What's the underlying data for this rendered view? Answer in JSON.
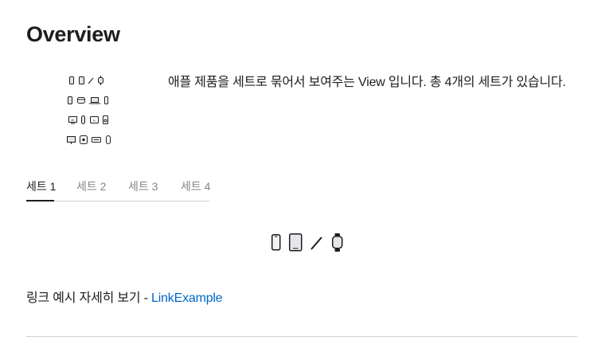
{
  "header": {
    "title": "Overview"
  },
  "preview": {
    "rows": [
      [
        "iphone-icon",
        "ipad-icon",
        "apple-pencil-icon",
        "apple-watch-icon"
      ],
      [
        "iphone-icon",
        "airpods-case-icon",
        "macbook-icon",
        "iphone-side-icon"
      ],
      [
        "apple-tv-4k-icon",
        "airtag-icon",
        "apple-tv-box-icon",
        "homepod-mini-icon"
      ],
      [
        "imac-icon",
        "mac-mini-icon",
        "keyboard-icon",
        "mouse-icon"
      ]
    ]
  },
  "description": "애플 제품을 세트로 묶어서 보여주는 View 입니다. 총 4개의 세트가 있습니다.",
  "tabs": [
    {
      "label": "세트 1",
      "active": true
    },
    {
      "label": "세트 2",
      "active": false
    },
    {
      "label": "세트 3",
      "active": false
    },
    {
      "label": "세트 4",
      "active": false
    }
  ],
  "selected_set": {
    "icons": [
      "iphone-icon",
      "ipad-icon",
      "apple-pencil-icon",
      "apple-watch-icon"
    ]
  },
  "link_section": {
    "prefix": "링크 예시 자세히 보기 - ",
    "link_label": "LinkExample"
  },
  "colors": {
    "text": "#1d1d1f",
    "muted": "#86868b",
    "link": "#0066cc",
    "border": "#d2d2d7"
  }
}
